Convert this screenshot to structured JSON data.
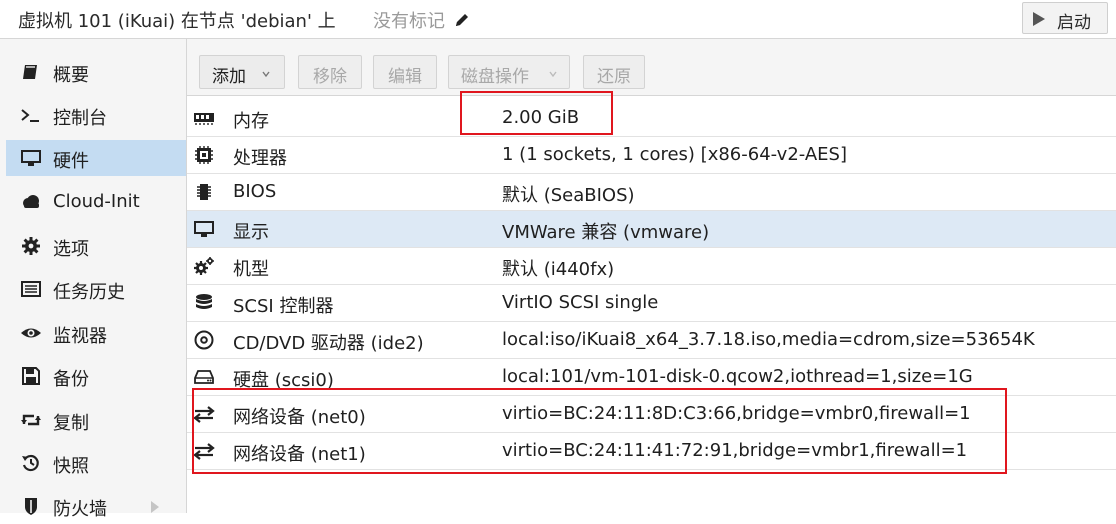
{
  "header": {
    "title": "虚拟机 101 (iKuai) 在节点 'debian' 上",
    "tags": "没有标记",
    "start_label": "启动"
  },
  "sidebar": {
    "items": [
      {
        "label": "概要",
        "icon": "book-icon"
      },
      {
        "label": "控制台",
        "icon": "terminal-icon"
      },
      {
        "label": "硬件",
        "icon": "monitor-icon",
        "active": true
      },
      {
        "label": "Cloud-Init",
        "icon": "cloud-icon"
      },
      {
        "label": "选项",
        "icon": "gear-icon"
      },
      {
        "label": "任务历史",
        "icon": "list-icon"
      },
      {
        "label": "监视器",
        "icon": "eye-icon"
      },
      {
        "label": "备份",
        "icon": "floppy-icon"
      },
      {
        "label": "复制",
        "icon": "retweet-icon"
      },
      {
        "label": "快照",
        "icon": "history-icon"
      },
      {
        "label": "防火墙",
        "icon": "shield-icon"
      }
    ]
  },
  "toolbar": {
    "add": "添加",
    "remove": "移除",
    "edit": "编辑",
    "disk_action": "磁盘操作",
    "revert": "还原"
  },
  "hardware": [
    {
      "name": "内存",
      "value": "2.00 GiB",
      "icon": "memory-icon"
    },
    {
      "name": "处理器",
      "value": "1 (1 sockets, 1 cores) [x86-64-v2-AES]",
      "icon": "cpu-icon"
    },
    {
      "name": "BIOS",
      "value": "默认 (SeaBIOS)",
      "icon": "chip-icon"
    },
    {
      "name": "显示",
      "value": "VMWare 兼容 (vmware)",
      "icon": "display-icon"
    },
    {
      "name": "机型",
      "value": "默认 (i440fx)",
      "icon": "cogs-icon"
    },
    {
      "name": "SCSI 控制器",
      "value": "VirtIO SCSI single",
      "icon": "database-icon"
    },
    {
      "name": "CD/DVD 驱动器 (ide2)",
      "value": "local:iso/iKuai8_x64_3.7.18.iso,media=cdrom,size=53654K",
      "icon": "cdrom-icon"
    },
    {
      "name": "硬盘 (scsi0)",
      "value": "local:101/vm-101-disk-0.qcow2,iothread=1,size=1G",
      "icon": "hdd-icon"
    },
    {
      "name": "网络设备 (net0)",
      "value": "virtio=BC:24:11:8D:C3:66,bridge=vmbr0,firewall=1",
      "icon": "exchange-icon"
    },
    {
      "name": "网络设备 (net1)",
      "value": "virtio=BC:24:11:41:72:91,bridge=vmbr1,firewall=1",
      "icon": "exchange-icon"
    }
  ],
  "colors": {
    "selection": "#c4dcf2",
    "row_highlight": "#dde9f5",
    "annotation_red": "#e0161e"
  }
}
